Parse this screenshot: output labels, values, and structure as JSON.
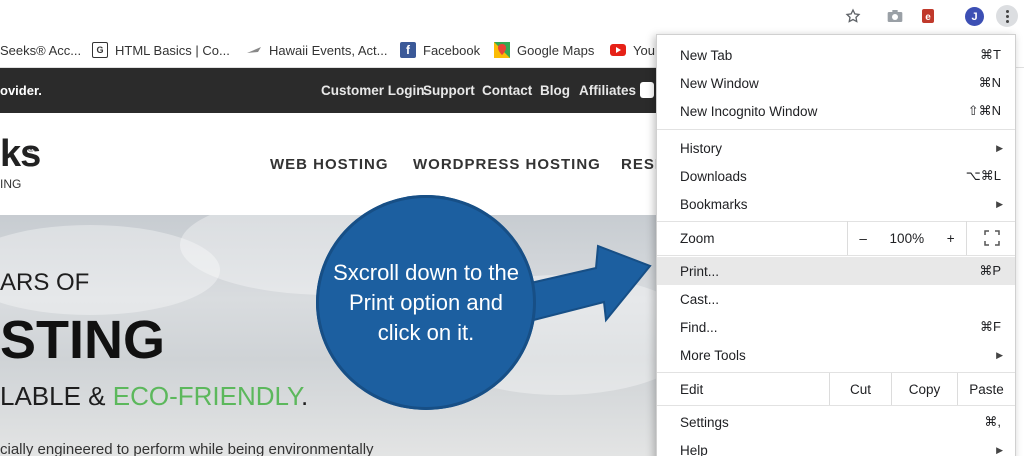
{
  "browser": {
    "avatar_letter": "J",
    "icons": [
      "star-icon",
      "camera-icon",
      "extension-icon",
      "more-vert-icon"
    ]
  },
  "bookmarks": [
    {
      "label": "Seeks® Acc...",
      "icon": "geeks-favicon"
    },
    {
      "label": "HTML Basics | Co...",
      "icon": "g-favicon"
    },
    {
      "label": "Hawaii Events, Act...",
      "icon": "plane-favicon"
    },
    {
      "label": "Facebook",
      "icon": "facebook-favicon"
    },
    {
      "label": "Google Maps",
      "icon": "google-maps-favicon"
    },
    {
      "label": "You",
      "icon": "youtube-favicon"
    }
  ],
  "site": {
    "tagline": "ovider.",
    "top_links": [
      "Customer Login",
      "Support",
      "Contact",
      "Blog",
      "Affiliates"
    ],
    "logo_main": "ks",
    "logo_reg": "®",
    "logo_sub": "ING",
    "nav": [
      "WEB HOSTING",
      "WORDPRESS HOSTING",
      "RESE"
    ],
    "hero": {
      "line1": "ARS OF",
      "line2": "STING",
      "line3_a": "LABLE & ",
      "line3_eco": "ECO-FRIENDLY",
      "line3_end": ".",
      "line4": "cially engineered to perform while being environmentally"
    }
  },
  "callout": {
    "text": "Sxcroll down to the Print option and click on it.",
    "color": "#1c5fa0"
  },
  "menu": {
    "new_tab": {
      "label": "New Tab",
      "shortcut": "⌘T"
    },
    "new_window": {
      "label": "New Window",
      "shortcut": "⌘N"
    },
    "incognito": {
      "label": "New Incognito Window",
      "shortcut": "⇧⌘N"
    },
    "history": {
      "label": "History"
    },
    "downloads": {
      "label": "Downloads",
      "shortcut": "⌥⌘L"
    },
    "bookmarks": {
      "label": "Bookmarks"
    },
    "zoom": {
      "label": "Zoom",
      "minus": "–",
      "value": "100%",
      "plus": "+"
    },
    "print": {
      "label": "Print...",
      "shortcut": "⌘P"
    },
    "cast": {
      "label": "Cast..."
    },
    "find": {
      "label": "Find...",
      "shortcut": "⌘F"
    },
    "more_tools": {
      "label": "More Tools"
    },
    "edit": {
      "label": "Edit",
      "cut": "Cut",
      "copy": "Copy",
      "paste": "Paste"
    },
    "settings": {
      "label": "Settings",
      "shortcut": "⌘,"
    },
    "help": {
      "label": "Help"
    }
  }
}
